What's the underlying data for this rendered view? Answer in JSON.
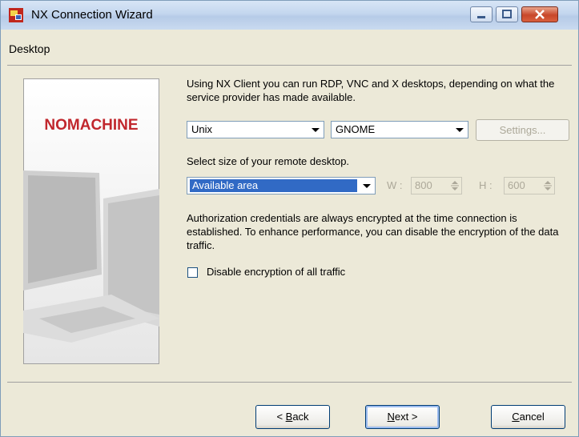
{
  "window": {
    "title": "NX Connection Wizard",
    "section": "Desktop"
  },
  "side_image": {
    "brand": "NOMACHINE"
  },
  "intro_text": "Using NX Client you can run RDP, VNC and X desktops, depending on what the service provider has made available.",
  "desktop": {
    "os_value": "Unix",
    "environment_value": "GNOME",
    "settings_label": "Settings..."
  },
  "size": {
    "label": "Select size of your remote desktop.",
    "value": "Available area",
    "w_label": "W :",
    "w_value": "800",
    "h_label": "H :",
    "h_value": "600"
  },
  "auth_text": "Authorization credentials are always encrypted at the time connection is established. To enhance performance, you can disable the encryption of the data traffic.",
  "encryption_checkbox": {
    "label": "Disable encryption of all traffic",
    "checked": false
  },
  "buttons": {
    "back_prefix": "< ",
    "back_key": "B",
    "back_rest": "ack",
    "next_key": "N",
    "next_rest": "ext >",
    "cancel_key": "C",
    "cancel_rest": "ancel"
  },
  "colors": {
    "selection": "#316ac5",
    "brand": "#c1272d"
  }
}
